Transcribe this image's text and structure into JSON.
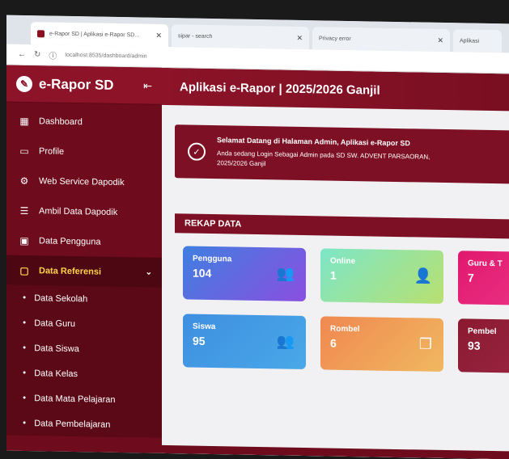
{
  "browser": {
    "tabs": [
      {
        "label": "e-Rapor SD | Aplikasi e-Rapor SD..."
      },
      {
        "label": "sipar - search"
      },
      {
        "label": "Privacy error"
      },
      {
        "label": "Aplikasi"
      }
    ],
    "url": "localhost:8535/dashboard/admin"
  },
  "sidebar": {
    "brand": "e-Rapor SD",
    "items": [
      {
        "label": "Dashboard",
        "icon": "dashboard-icon"
      },
      {
        "label": "Profile",
        "icon": "profile-icon"
      },
      {
        "label": "Web Service Dapodik",
        "icon": "gear-icon"
      },
      {
        "label": "Ambil Data Dapodik",
        "icon": "database-icon"
      },
      {
        "label": "Data Pengguna",
        "icon": "users-icon"
      },
      {
        "label": "Data Referensi",
        "icon": "folder-icon"
      }
    ],
    "subitems": [
      {
        "label": "Data Sekolah"
      },
      {
        "label": "Data Guru"
      },
      {
        "label": "Data Siswa"
      },
      {
        "label": "Data Kelas"
      },
      {
        "label": "Data Mata Pelajaran"
      },
      {
        "label": "Data Pembelajaran"
      }
    ]
  },
  "header": {
    "title": "Aplikasi e-Rapor | 2025/2026 Ganjil"
  },
  "banner": {
    "title": "Selamat Datang di Halaman Admin, Aplikasi e-Rapor SD",
    "line1": "Anda sedang Login Sebagai Admin pada SD SW. ADVENT PARSAORAN,",
    "line2": "2025/2026 Ganjil"
  },
  "rekap": {
    "title": "REKAP DATA",
    "cards": [
      {
        "label": "Pengguna",
        "value": "104",
        "color": "#6a5ce0",
        "icon": "users-icon"
      },
      {
        "label": "Online",
        "value": "1",
        "color": "#7ee0c4",
        "icon": "user-online-icon"
      },
      {
        "label": "Guru & T",
        "value": "7",
        "color": "#e0186e",
        "icon": "teacher-icon"
      },
      {
        "label": "Siswa",
        "value": "95",
        "color": "#3e8fe0",
        "icon": "students-icon"
      },
      {
        "label": "Rombel",
        "value": "6",
        "color": "#f0a050",
        "icon": "class-icon"
      },
      {
        "label": "Pembel",
        "value": "93",
        "color": "#8a1a30",
        "icon": "lesson-icon"
      }
    ]
  }
}
